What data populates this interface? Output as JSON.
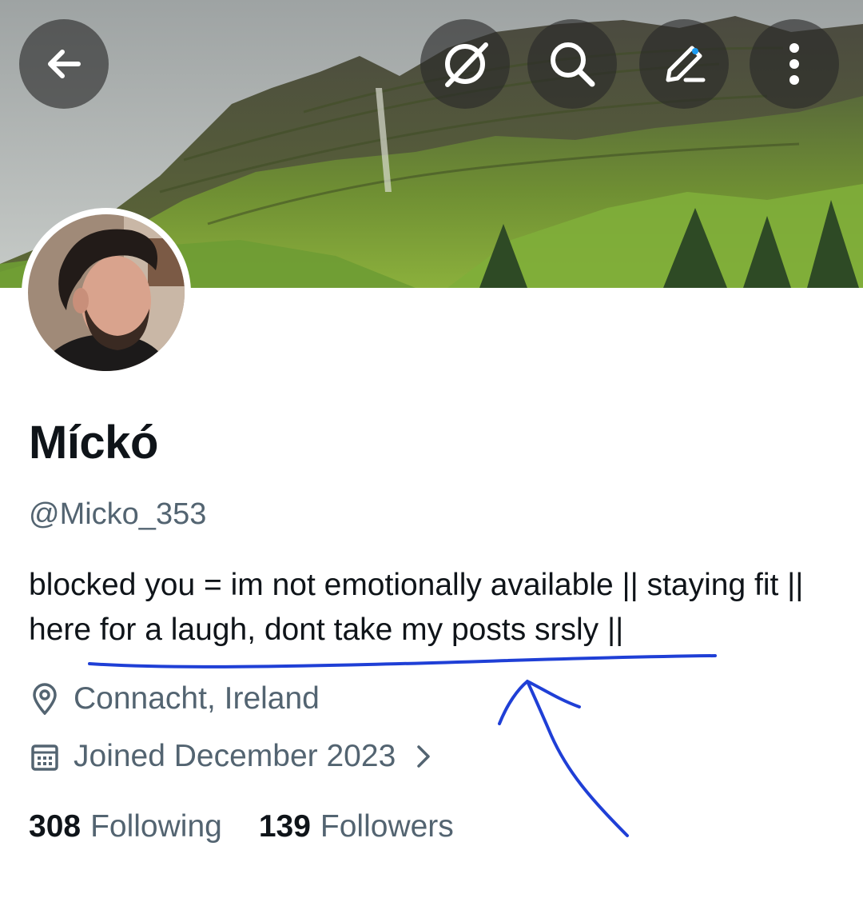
{
  "header": {
    "buttons": {
      "back": "back-arrow",
      "grok": "grok-icon",
      "search": "search-icon",
      "edit": "edit-icon",
      "more": "more-vertical-icon"
    }
  },
  "profile": {
    "display_name": "Míckó",
    "handle": "@Micko_353",
    "bio": "blocked you = im not emotionally available || staying fit || here for a laugh, dont take my posts srsly ||",
    "location": "Connacht, Ireland",
    "joined": "Joined December 2023",
    "following_count": "308",
    "following_label": "Following",
    "followers_count": "139",
    "followers_label": "Followers"
  },
  "colors": {
    "text_primary": "#0f1419",
    "text_secondary": "#536471",
    "annotation_ink": "#1f3fd6",
    "overlay_button": "#333333"
  }
}
